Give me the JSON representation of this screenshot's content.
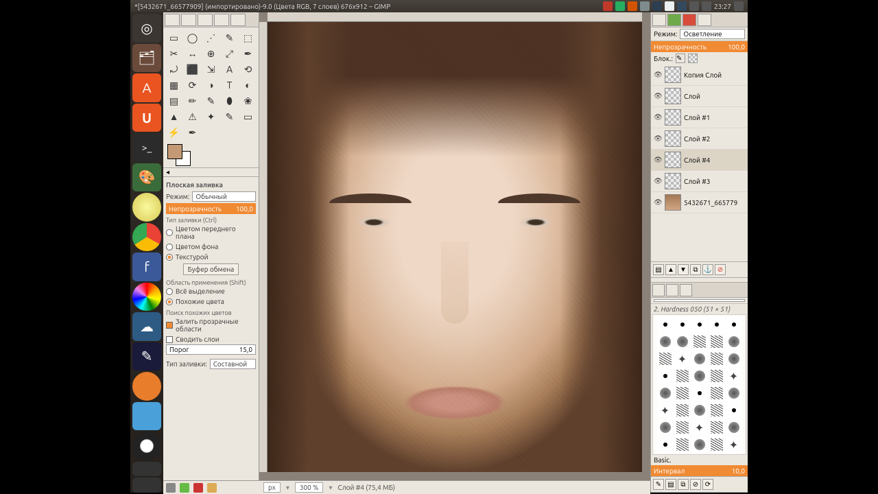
{
  "menubar": {
    "title": "*[5432671_66577909] (импортировано)-9.0 (Цвета RGB, 7 слоев) 676x912 – GIMP",
    "clock": "23:27"
  },
  "launcher": {
    "items": [
      "dash",
      "files",
      "amazon",
      "ubuntu",
      "term",
      "gimp",
      "disk",
      "chrome",
      "fb",
      "color",
      "cloud",
      "kden",
      "blender",
      "blue",
      "audacity",
      "small1",
      "small2"
    ]
  },
  "toolbox": {
    "section_title": "Плоская заливка",
    "mode_label": "Режим:",
    "mode_value": "Обычный",
    "opacity_label": "Непрозрачность",
    "opacity_value": "100,0",
    "fill_type_label": "Тип заливки (Ctrl)",
    "fill_options": {
      "fg": "Цветом переднего плана",
      "bg": "Цветом фона",
      "pattern": "Текстурой"
    },
    "pattern_btn": "Буфер обмена",
    "region_label": "Область применения (Shift)",
    "region_all": "Всё выделение",
    "region_similar": "Похожие цвета",
    "similar_label": "Поиск похожих цветов",
    "fill_transparent": "Залить прозрачные области",
    "merge_layers": "Сводить слои",
    "threshold_label": "Порог",
    "threshold_value": "15,0",
    "fillmode_label": "Тип заливки:",
    "fillmode_value": "Составной"
  },
  "canvas": {
    "cursor_name": "cursor"
  },
  "status": {
    "units": "px",
    "zoom": "300 %",
    "layer_info": "Слой #4 (75,4 МБ)"
  },
  "layers": {
    "mode_label": "Режим:",
    "mode_value": "Осветление",
    "opacity_label": "Непрозрачность",
    "opacity_value": "100,0",
    "lock_label": "Блок.:",
    "items": [
      {
        "name": "Копия Слой",
        "active": false,
        "img": false
      },
      {
        "name": "Слой",
        "active": false,
        "img": false
      },
      {
        "name": "Слой #1",
        "active": false,
        "img": false
      },
      {
        "name": "Слой #2",
        "active": false,
        "img": false
      },
      {
        "name": "Слой #4",
        "active": true,
        "img": false
      },
      {
        "name": "Слой #3",
        "active": false,
        "img": false
      },
      {
        "name": "5432671_665779",
        "active": false,
        "img": true
      }
    ]
  },
  "brushes": {
    "info": "2. Hardness 050 (51 × 51)",
    "preset_label": "Basic.",
    "spacing_label": "Интервал",
    "spacing_value": "10,0"
  },
  "tools": [
    "▭",
    "◯",
    "⋰",
    "✎",
    "⬚",
    "✂",
    "↔",
    "⊕",
    "⤢",
    "✒",
    "⤾",
    "⬛",
    "⇲",
    "A",
    "⟲",
    "▦",
    "⟳",
    "◑",
    "T",
    "◐",
    "▤",
    "✏",
    "✎",
    "⬮",
    "❀",
    "▲",
    "⚠",
    "✦",
    "✎",
    "▭",
    "⚡",
    "✒"
  ],
  "brush_cells": 40
}
